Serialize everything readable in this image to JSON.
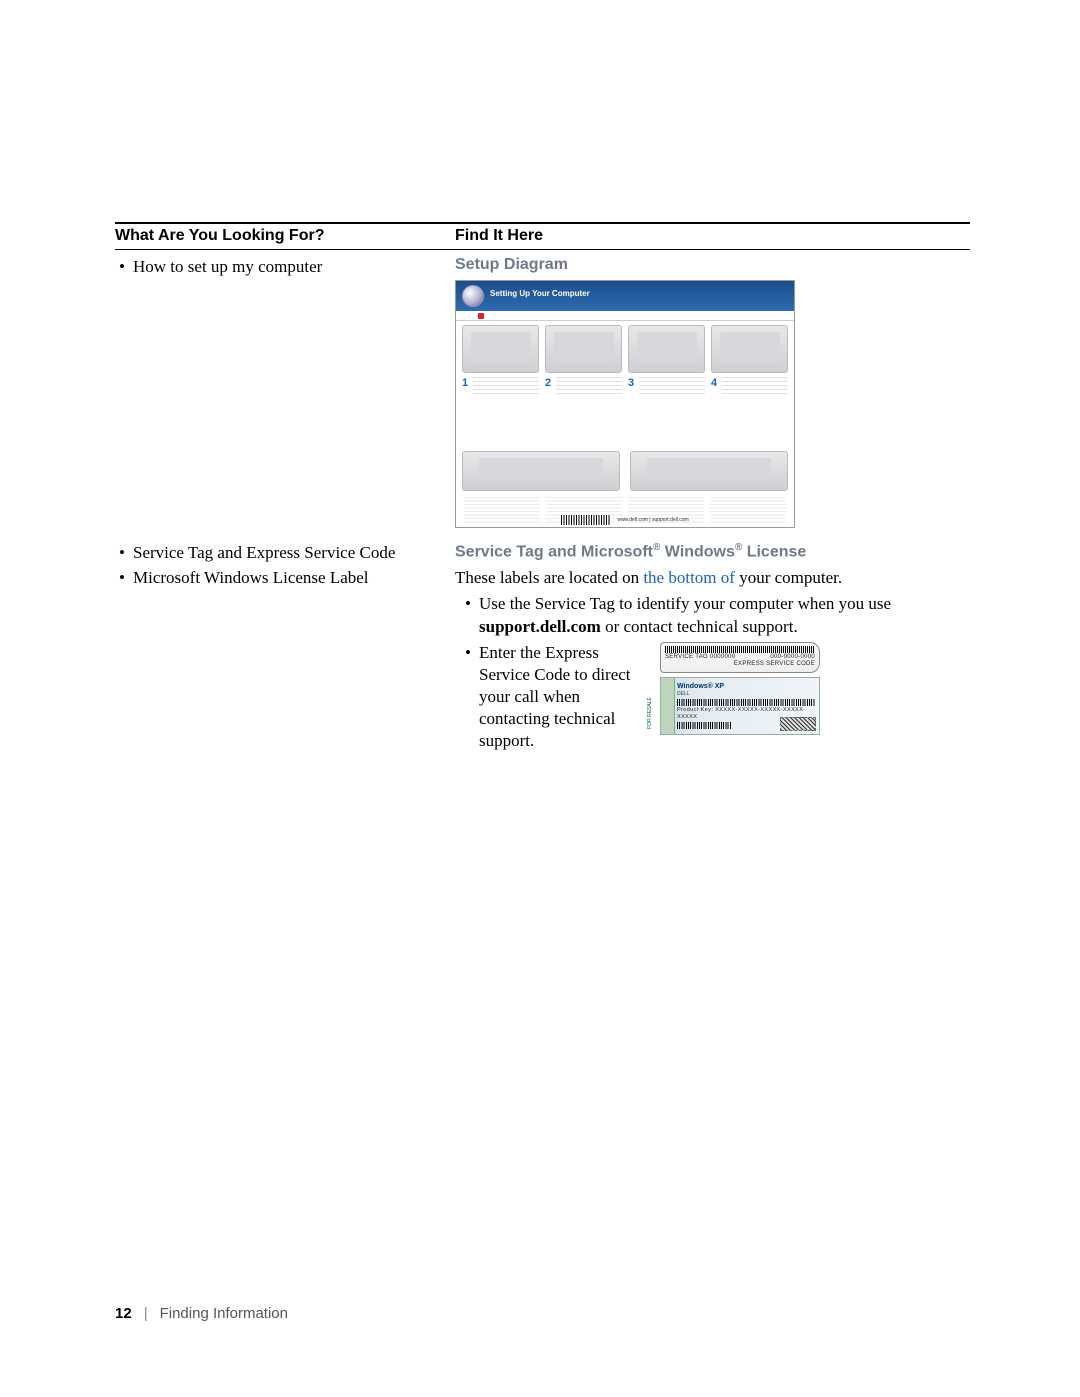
{
  "header": {
    "left": "What Are You Looking For?",
    "right": "Find It Here"
  },
  "row1": {
    "left_bullets": [
      "How to set up my computer"
    ],
    "right_heading": "Setup Diagram",
    "diagram": {
      "band_title": "Setting Up Your Computer",
      "steps": [
        "1",
        "2",
        "3",
        "4"
      ],
      "footer_url": "www.dell.com | support.dell.com"
    }
  },
  "row2": {
    "left_bullets": [
      "Service Tag and Express Service Code",
      "Microsoft Windows License Label"
    ],
    "right_heading_parts": {
      "a": "Service Tag and Microsoft",
      "b": " Windows",
      "c": " License"
    },
    "lead_a": "These labels are located on ",
    "lead_link": "the bottom of",
    "lead_b": " your computer.",
    "bullet1_a": "Use the Service Tag to identify your computer when you use ",
    "bullet1_bold": "support.dell.com",
    "bullet1_b": " or contact technical support.",
    "bullet2": "Enter the Express Service Code to direct your call when contacting technical support.",
    "tag": {
      "line1": "SERVICE TAG   0000000",
      "line2": "EXPRESS SERVICE CODE",
      "line3": "000-0000-0000"
    },
    "coa": {
      "title": "Windows® XP",
      "brand": "DELL",
      "key": "Product Key: XXXXX-XXXXX-XXXXX-XXXXX-XXXXX",
      "side": "FOR RESALE"
    }
  },
  "footer": {
    "page": "12",
    "divider": "|",
    "section": "Finding Information"
  }
}
